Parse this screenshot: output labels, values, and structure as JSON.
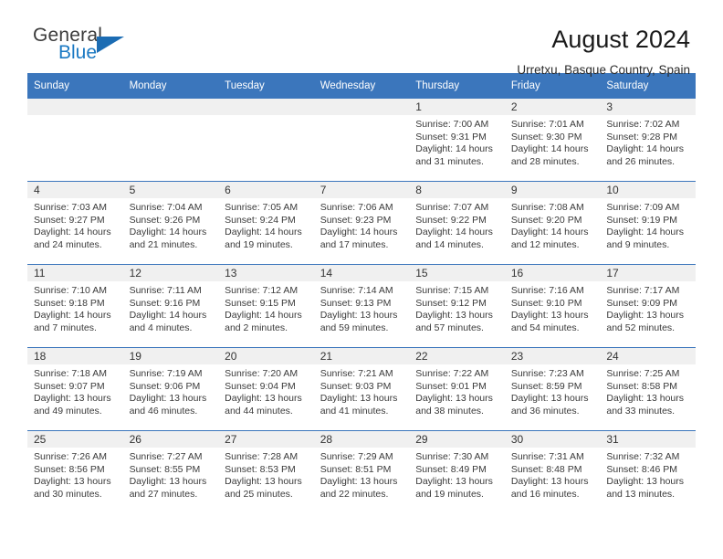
{
  "brand": {
    "name_part1": "General",
    "name_part2": "Blue",
    "logo_icon": "blue-triangle-icon"
  },
  "header": {
    "title": "August 2024",
    "subtitle": "Urretxu, Basque Country, Spain"
  },
  "colors": {
    "header_blue": "#3b76bc",
    "logo_blue": "#1b79c3",
    "daynum_bg": "#f0f0f0"
  },
  "weekdays": [
    "Sunday",
    "Monday",
    "Tuesday",
    "Wednesday",
    "Thursday",
    "Friday",
    "Saturday"
  ],
  "weeks": [
    [
      {
        "day": "",
        "empty": true
      },
      {
        "day": "",
        "empty": true
      },
      {
        "day": "",
        "empty": true
      },
      {
        "day": "",
        "empty": true
      },
      {
        "day": "1",
        "sunrise": "Sunrise: 7:00 AM",
        "sunset": "Sunset: 9:31 PM",
        "daylight1": "Daylight: 14 hours",
        "daylight2": "and 31 minutes."
      },
      {
        "day": "2",
        "sunrise": "Sunrise: 7:01 AM",
        "sunset": "Sunset: 9:30 PM",
        "daylight1": "Daylight: 14 hours",
        "daylight2": "and 28 minutes."
      },
      {
        "day": "3",
        "sunrise": "Sunrise: 7:02 AM",
        "sunset": "Sunset: 9:28 PM",
        "daylight1": "Daylight: 14 hours",
        "daylight2": "and 26 minutes."
      }
    ],
    [
      {
        "day": "4",
        "sunrise": "Sunrise: 7:03 AM",
        "sunset": "Sunset: 9:27 PM",
        "daylight1": "Daylight: 14 hours",
        "daylight2": "and 24 minutes."
      },
      {
        "day": "5",
        "sunrise": "Sunrise: 7:04 AM",
        "sunset": "Sunset: 9:26 PM",
        "daylight1": "Daylight: 14 hours",
        "daylight2": "and 21 minutes."
      },
      {
        "day": "6",
        "sunrise": "Sunrise: 7:05 AM",
        "sunset": "Sunset: 9:24 PM",
        "daylight1": "Daylight: 14 hours",
        "daylight2": "and 19 minutes."
      },
      {
        "day": "7",
        "sunrise": "Sunrise: 7:06 AM",
        "sunset": "Sunset: 9:23 PM",
        "daylight1": "Daylight: 14 hours",
        "daylight2": "and 17 minutes."
      },
      {
        "day": "8",
        "sunrise": "Sunrise: 7:07 AM",
        "sunset": "Sunset: 9:22 PM",
        "daylight1": "Daylight: 14 hours",
        "daylight2": "and 14 minutes."
      },
      {
        "day": "9",
        "sunrise": "Sunrise: 7:08 AM",
        "sunset": "Sunset: 9:20 PM",
        "daylight1": "Daylight: 14 hours",
        "daylight2": "and 12 minutes."
      },
      {
        "day": "10",
        "sunrise": "Sunrise: 7:09 AM",
        "sunset": "Sunset: 9:19 PM",
        "daylight1": "Daylight: 14 hours",
        "daylight2": "and 9 minutes."
      }
    ],
    [
      {
        "day": "11",
        "sunrise": "Sunrise: 7:10 AM",
        "sunset": "Sunset: 9:18 PM",
        "daylight1": "Daylight: 14 hours",
        "daylight2": "and 7 minutes."
      },
      {
        "day": "12",
        "sunrise": "Sunrise: 7:11 AM",
        "sunset": "Sunset: 9:16 PM",
        "daylight1": "Daylight: 14 hours",
        "daylight2": "and 4 minutes."
      },
      {
        "day": "13",
        "sunrise": "Sunrise: 7:12 AM",
        "sunset": "Sunset: 9:15 PM",
        "daylight1": "Daylight: 14 hours",
        "daylight2": "and 2 minutes."
      },
      {
        "day": "14",
        "sunrise": "Sunrise: 7:14 AM",
        "sunset": "Sunset: 9:13 PM",
        "daylight1": "Daylight: 13 hours",
        "daylight2": "and 59 minutes."
      },
      {
        "day": "15",
        "sunrise": "Sunrise: 7:15 AM",
        "sunset": "Sunset: 9:12 PM",
        "daylight1": "Daylight: 13 hours",
        "daylight2": "and 57 minutes."
      },
      {
        "day": "16",
        "sunrise": "Sunrise: 7:16 AM",
        "sunset": "Sunset: 9:10 PM",
        "daylight1": "Daylight: 13 hours",
        "daylight2": "and 54 minutes."
      },
      {
        "day": "17",
        "sunrise": "Sunrise: 7:17 AM",
        "sunset": "Sunset: 9:09 PM",
        "daylight1": "Daylight: 13 hours",
        "daylight2": "and 52 minutes."
      }
    ],
    [
      {
        "day": "18",
        "sunrise": "Sunrise: 7:18 AM",
        "sunset": "Sunset: 9:07 PM",
        "daylight1": "Daylight: 13 hours",
        "daylight2": "and 49 minutes."
      },
      {
        "day": "19",
        "sunrise": "Sunrise: 7:19 AM",
        "sunset": "Sunset: 9:06 PM",
        "daylight1": "Daylight: 13 hours",
        "daylight2": "and 46 minutes."
      },
      {
        "day": "20",
        "sunrise": "Sunrise: 7:20 AM",
        "sunset": "Sunset: 9:04 PM",
        "daylight1": "Daylight: 13 hours",
        "daylight2": "and 44 minutes."
      },
      {
        "day": "21",
        "sunrise": "Sunrise: 7:21 AM",
        "sunset": "Sunset: 9:03 PM",
        "daylight1": "Daylight: 13 hours",
        "daylight2": "and 41 minutes."
      },
      {
        "day": "22",
        "sunrise": "Sunrise: 7:22 AM",
        "sunset": "Sunset: 9:01 PM",
        "daylight1": "Daylight: 13 hours",
        "daylight2": "and 38 minutes."
      },
      {
        "day": "23",
        "sunrise": "Sunrise: 7:23 AM",
        "sunset": "Sunset: 8:59 PM",
        "daylight1": "Daylight: 13 hours",
        "daylight2": "and 36 minutes."
      },
      {
        "day": "24",
        "sunrise": "Sunrise: 7:25 AM",
        "sunset": "Sunset: 8:58 PM",
        "daylight1": "Daylight: 13 hours",
        "daylight2": "and 33 minutes."
      }
    ],
    [
      {
        "day": "25",
        "sunrise": "Sunrise: 7:26 AM",
        "sunset": "Sunset: 8:56 PM",
        "daylight1": "Daylight: 13 hours",
        "daylight2": "and 30 minutes."
      },
      {
        "day": "26",
        "sunrise": "Sunrise: 7:27 AM",
        "sunset": "Sunset: 8:55 PM",
        "daylight1": "Daylight: 13 hours",
        "daylight2": "and 27 minutes."
      },
      {
        "day": "27",
        "sunrise": "Sunrise: 7:28 AM",
        "sunset": "Sunset: 8:53 PM",
        "daylight1": "Daylight: 13 hours",
        "daylight2": "and 25 minutes."
      },
      {
        "day": "28",
        "sunrise": "Sunrise: 7:29 AM",
        "sunset": "Sunset: 8:51 PM",
        "daylight1": "Daylight: 13 hours",
        "daylight2": "and 22 minutes."
      },
      {
        "day": "29",
        "sunrise": "Sunrise: 7:30 AM",
        "sunset": "Sunset: 8:49 PM",
        "daylight1": "Daylight: 13 hours",
        "daylight2": "and 19 minutes."
      },
      {
        "day": "30",
        "sunrise": "Sunrise: 7:31 AM",
        "sunset": "Sunset: 8:48 PM",
        "daylight1": "Daylight: 13 hours",
        "daylight2": "and 16 minutes."
      },
      {
        "day": "31",
        "sunrise": "Sunrise: 7:32 AM",
        "sunset": "Sunset: 8:46 PM",
        "daylight1": "Daylight: 13 hours",
        "daylight2": "and 13 minutes."
      }
    ]
  ]
}
